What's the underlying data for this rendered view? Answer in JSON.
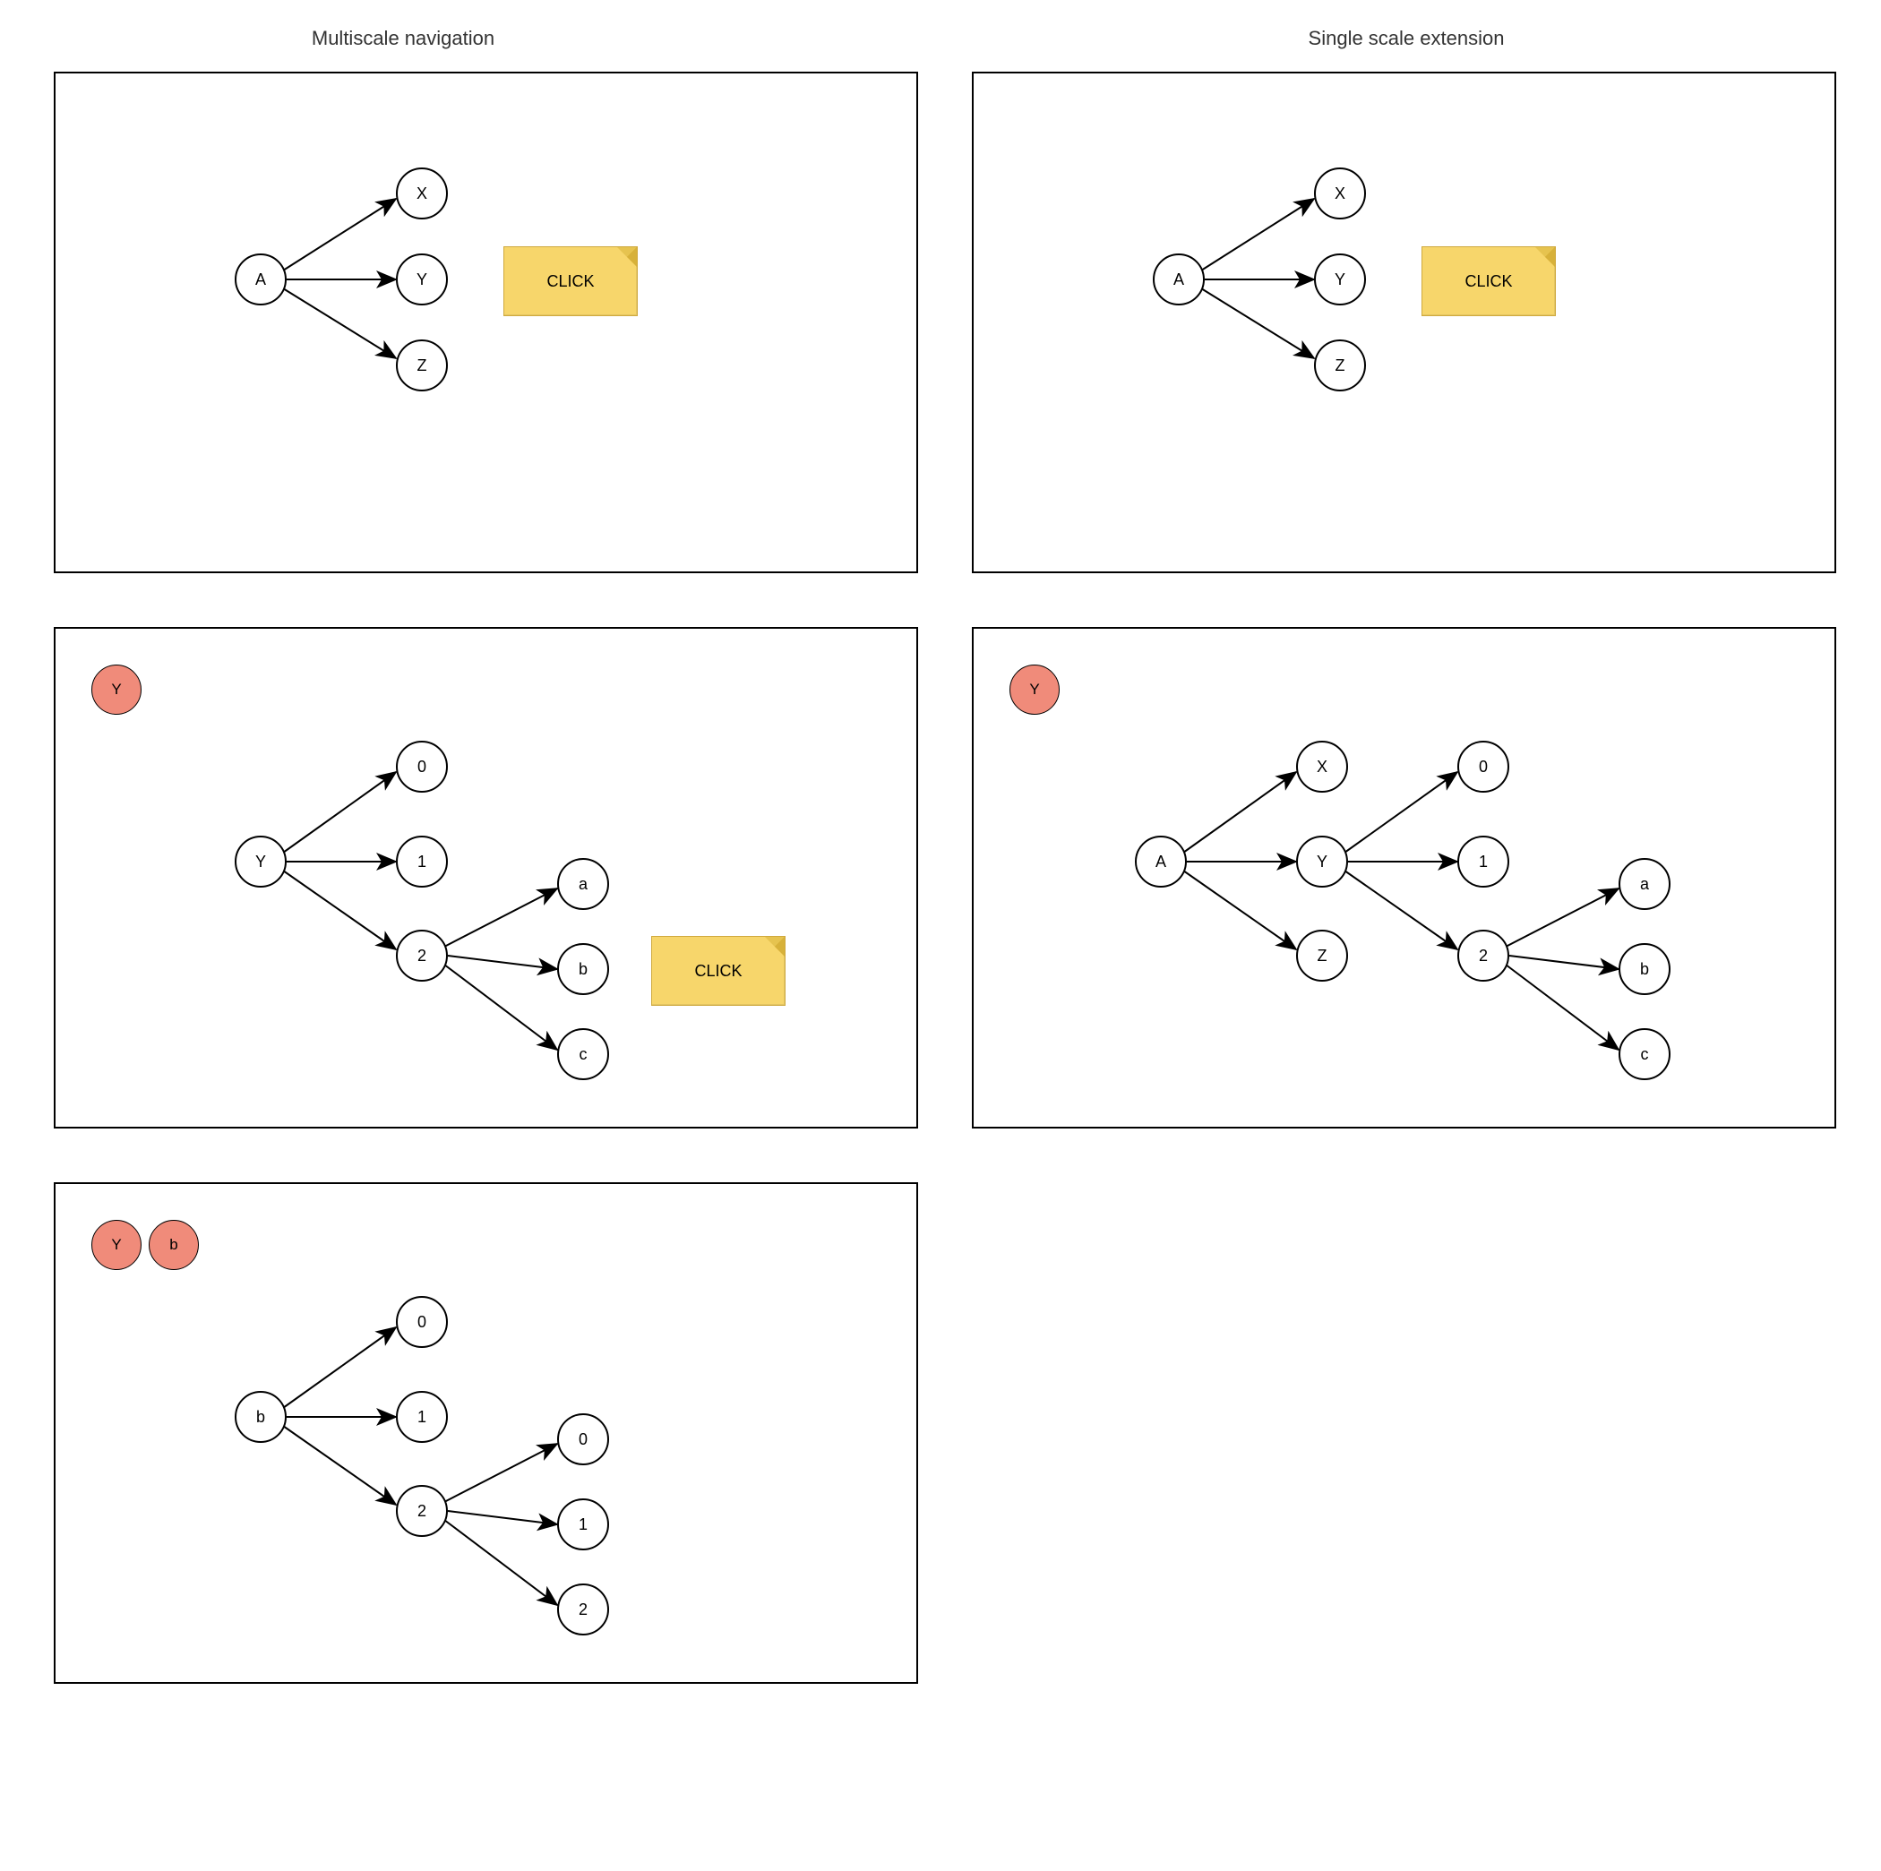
{
  "titles": {
    "left": "Multiscale navigation",
    "right": "Single scale extension"
  },
  "sticky": {
    "click": "CLICK"
  },
  "panels": {
    "p1": {
      "root": "A",
      "children": [
        "X",
        "Y",
        "Z"
      ]
    },
    "p2": {
      "root": "A",
      "children": [
        "X",
        "Y",
        "Z"
      ]
    },
    "p3": {
      "badge": "Y",
      "root": "Y",
      "children": [
        "0",
        "1",
        "2"
      ],
      "grandchildren": [
        "a",
        "b",
        "c"
      ]
    },
    "p4": {
      "badge": "Y",
      "root": "A",
      "children": [
        "X",
        "Y",
        "Z"
      ],
      "grandchildren": [
        "0",
        "1",
        "2"
      ],
      "greatgrandchildren": [
        "a",
        "b",
        "c"
      ]
    },
    "p5": {
      "badges": [
        "Y",
        "b"
      ],
      "root": "b",
      "children": [
        "0",
        "1",
        "2"
      ],
      "grandchildren": [
        "0",
        "1",
        "2"
      ]
    }
  }
}
